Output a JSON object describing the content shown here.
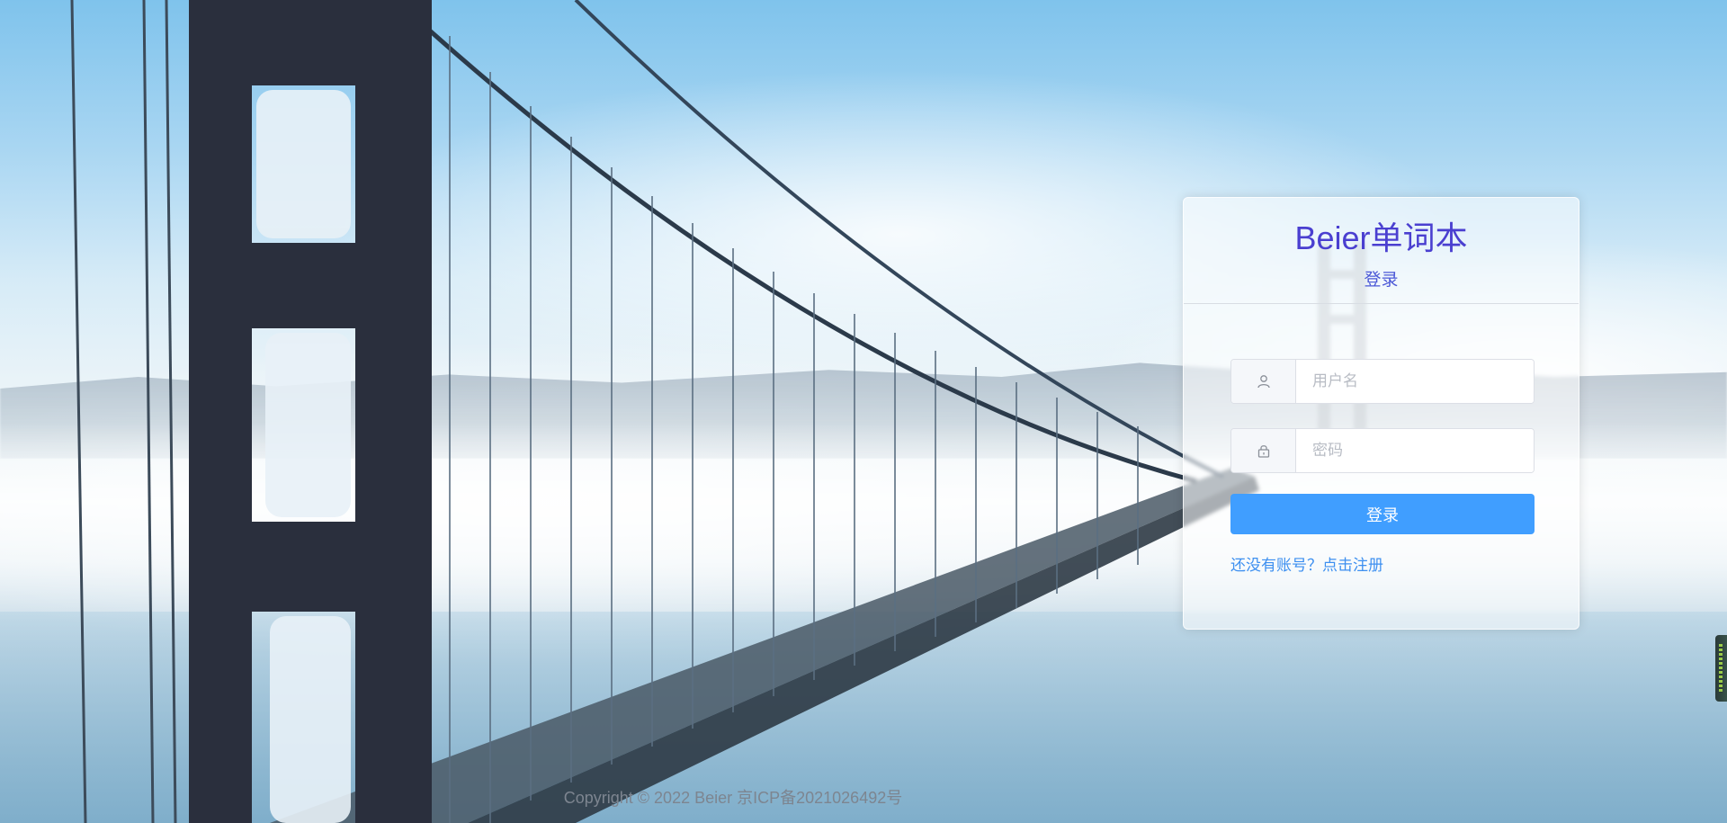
{
  "header": {
    "app_title": "Beier单词本",
    "subtitle": "登录"
  },
  "form": {
    "username_placeholder": "用户名",
    "password_placeholder": "密码",
    "login_button": "登录",
    "register_link": "还没有账号？点击注册"
  },
  "icons": {
    "username": "user-icon",
    "password": "lock-icon"
  },
  "footer": {
    "copyright": "Copyright © 2022 Beier 京ICP备2021026492号"
  },
  "colors": {
    "title": "#4a3fd0",
    "primary": "#409eff",
    "link": "#3d8ff0"
  }
}
